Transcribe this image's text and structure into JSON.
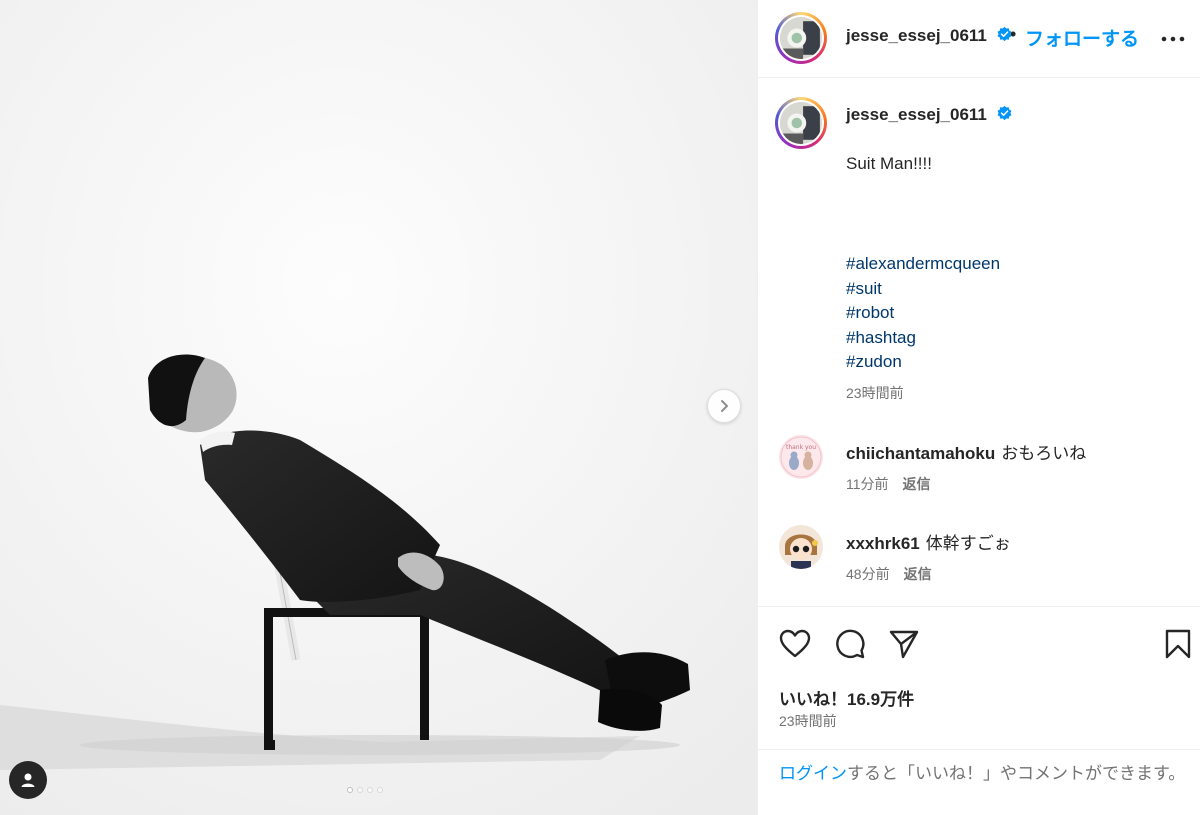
{
  "post": {
    "username": "jesse_essej_0611",
    "verified": true,
    "follow_label": "フォローする",
    "separator": "•",
    "caption": "Suit Man!!!!",
    "hashtags": [
      "#alexandermcqueen",
      "#suit",
      "#robot",
      "#hashtag",
      "#zudon"
    ],
    "caption_time": "23時間前",
    "likes": "いいね！16.9万件",
    "post_time": "23時間前",
    "login_prompt": {
      "link": "ログイン",
      "rest": "すると「いいね！」やコメントができます。"
    }
  },
  "media": {
    "carousel_count": 4,
    "active_index": 0
  },
  "comments": [
    {
      "username": "chiichantamahoku",
      "text": "おもろいね",
      "time": "11分前",
      "reply_label": "返信",
      "avatar_text": "thank you"
    },
    {
      "username": "xxxhrk61",
      "text": "体幹すごぉ",
      "time": "48分前",
      "reply_label": "返信"
    }
  ],
  "icons": {
    "more": "more-options-icon",
    "like": "heart-icon",
    "comment": "comment-icon",
    "share": "share-icon",
    "save": "bookmark-icon",
    "next": "chevron-right-icon",
    "user_tag": "user-tag-icon",
    "verified": "verified-badge-icon"
  },
  "colors": {
    "accent": "#0095f6",
    "hashtag": "#00376b",
    "muted": "#737373",
    "text": "#262626",
    "verified": "#0095f6"
  }
}
